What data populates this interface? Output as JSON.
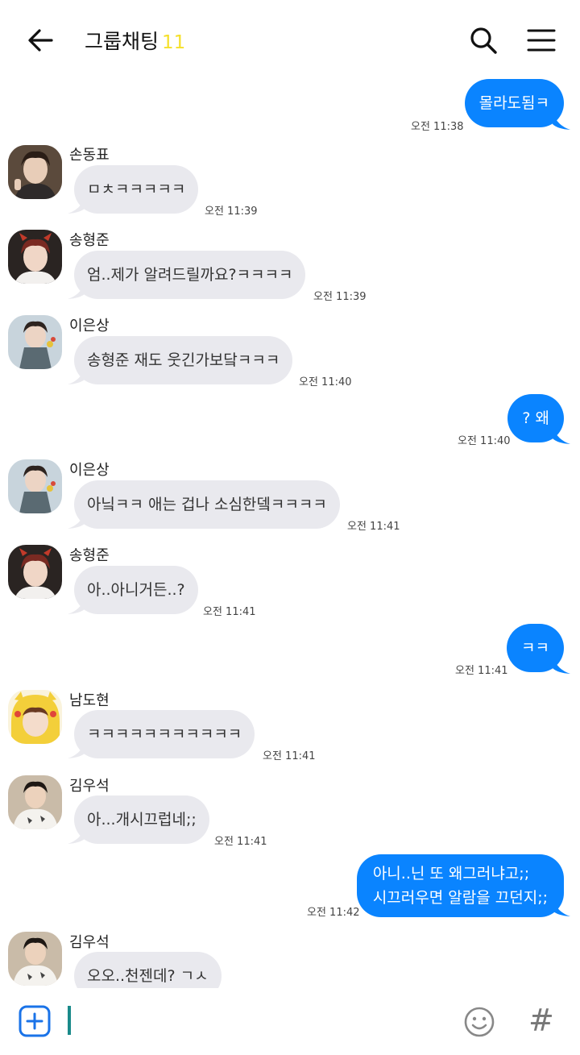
{
  "header": {
    "title": "그룹채팅",
    "member_count": "11",
    "back_icon": "arrow-left-icon",
    "search_icon": "search-icon",
    "menu_icon": "hamburger-menu-icon"
  },
  "messages": [
    {
      "type": "out",
      "text": "몰라도됨ㅋ",
      "time": "오전 11:38"
    },
    {
      "type": "in",
      "sender": "손동표",
      "text": "ㅁㅊㅋㅋㅋㅋㅋ",
      "time": "오전 11:39"
    },
    {
      "type": "in",
      "sender": "송형준",
      "text": "엄..제가 알려드릴까요?ㅋㅋㅋㅋ",
      "time": "오전 11:39"
    },
    {
      "type": "in",
      "sender": "이은상",
      "text": "송형준 재도 웃긴가보닼ㅋㅋㅋ",
      "time": "오전 11:40"
    },
    {
      "type": "out",
      "text": "? 왜",
      "time": "오전 11:40"
    },
    {
      "type": "in",
      "sender": "이은상",
      "text": "아닠ㅋㅋ 애는 겁나 소심한뎈ㅋㅋㅋㅋ",
      "time": "오전 11:41"
    },
    {
      "type": "in",
      "sender": "송형준",
      "text": "아..아니거든..?",
      "time": "오전 11:41"
    },
    {
      "type": "out",
      "text": "ㅋㅋ",
      "time": "오전 11:41"
    },
    {
      "type": "in",
      "sender": "남도현",
      "text": "ㅋㅋㅋㅋㅋㅋㅋㅋㅋㅋㅋ",
      "time": "오전 11:41"
    },
    {
      "type": "in",
      "sender": "김우석",
      "text": "아...개시끄럽네;;",
      "time": "오전 11:41"
    },
    {
      "type": "out",
      "line1": "아니..닌 또 왜그러냐고;;",
      "line2": "시끄러우면 알람을 끄던지;;",
      "time": "오전 11:42"
    },
    {
      "type": "in",
      "sender": "김우석",
      "text": "오오..천젠데? ㄱㅅ",
      "time": ""
    }
  ],
  "input": {
    "add_icon": "plus-square-icon",
    "emoji_icon": "smiley-icon",
    "hash_symbol": "#"
  },
  "colors": {
    "outgoing_bubble": "#0a84ff",
    "incoming_bubble": "#e9e9ee",
    "member_count": "#f5e02a"
  }
}
